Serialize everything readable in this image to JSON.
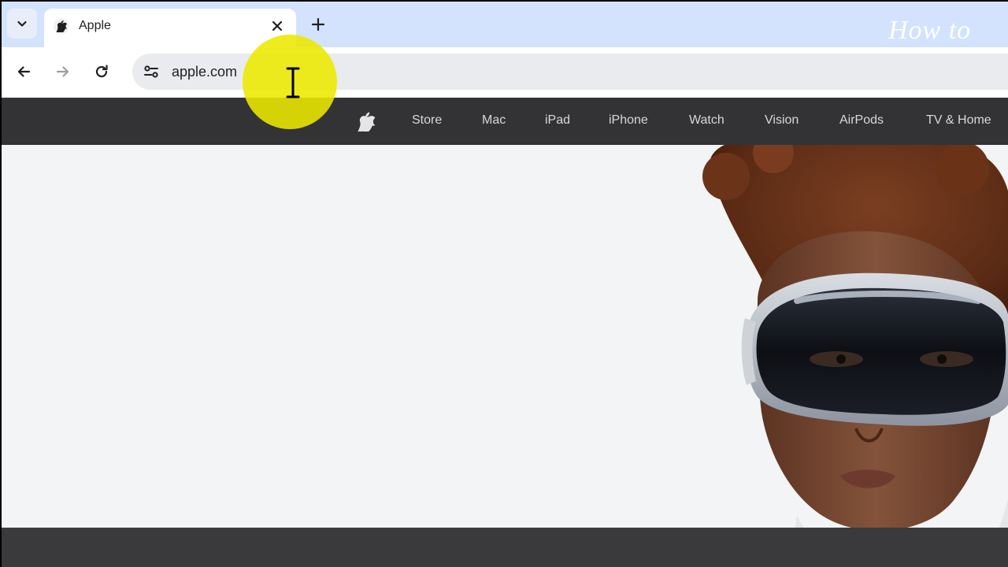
{
  "browser": {
    "tab": {
      "title": "Apple"
    },
    "address_bar": {
      "value": "apple.com"
    },
    "watermark": "How to"
  },
  "apple_nav": {
    "items": [
      {
        "label": "Store"
      },
      {
        "label": "Mac"
      },
      {
        "label": "iPad"
      },
      {
        "label": "iPhone"
      },
      {
        "label": "Watch"
      },
      {
        "label": "Vision"
      },
      {
        "label": "AirPods"
      },
      {
        "label": "TV & Home"
      }
    ]
  },
  "icons": {
    "tab_search": "chevron-down-icon",
    "tab_close": "close-icon",
    "new_tab": "plus-icon",
    "back": "arrow-left-icon",
    "forward": "arrow-right-icon",
    "reload": "reload-icon",
    "site_info": "tune-icon",
    "apple_logo": "apple-logo-icon"
  },
  "colors": {
    "tabstrip": "#d3e3fd",
    "apple_nav_bg": "#333336",
    "hero_bg": "#f2f4f5",
    "cursor_highlight": "#ece800"
  }
}
